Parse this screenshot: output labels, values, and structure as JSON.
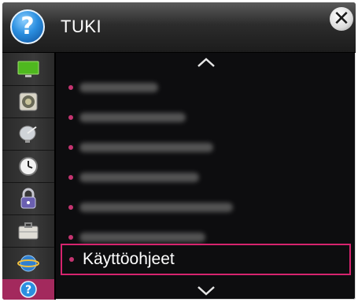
{
  "window": {
    "title": "TUKI",
    "title_icon": "question-icon",
    "close_icon": "close-icon"
  },
  "sidebar": {
    "items": [
      {
        "icon": "picture-icon",
        "selected": false
      },
      {
        "icon": "sound-icon",
        "selected": false
      },
      {
        "icon": "channel-icon",
        "selected": false
      },
      {
        "icon": "clock-icon",
        "selected": false
      },
      {
        "icon": "lock-icon",
        "selected": false
      },
      {
        "icon": "options-icon",
        "selected": false
      },
      {
        "icon": "network-icon",
        "selected": false
      },
      {
        "icon": "support-icon",
        "selected": true
      }
    ]
  },
  "menu": {
    "items": [
      {
        "label": "",
        "blurred": true
      },
      {
        "label": "",
        "blurred": true
      },
      {
        "label": "",
        "blurred": true
      },
      {
        "label": "",
        "blurred": true
      },
      {
        "label": "",
        "blurred": true
      },
      {
        "label": "",
        "blurred": true
      },
      {
        "label": "Käyttöohjeet",
        "blurred": false,
        "active": true
      }
    ],
    "scroll_up_icon": "chevron-up-icon",
    "scroll_down_icon": "chevron-down-icon"
  },
  "colors": {
    "accent": "#d6246e",
    "selected_sidebar": "#a3295d",
    "bullet": "#c43470"
  }
}
